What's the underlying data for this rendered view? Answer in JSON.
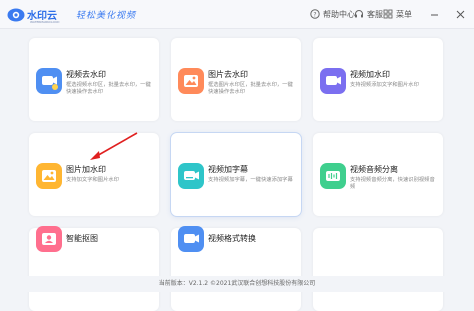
{
  "app": {
    "name": "水印云",
    "subtitle": "WATERMARKCLOUD",
    "slogan": "轻松美化视频"
  },
  "toolbar": {
    "help_label": "帮助中心",
    "service_label": "客服",
    "menu_label": "菜单"
  },
  "cards": [
    {
      "title": "视频去水印",
      "desc": "框选视频水印区，批量去水印，一键快速操作去水印"
    },
    {
      "title": "图片去水印",
      "desc": "框选图片水印区，批量去水印，一键快速操作去水印"
    },
    {
      "title": "视频加水印",
      "desc": "支持视频添加文字和图片水印"
    },
    {
      "title": "图片加水印",
      "desc": "支持加文字和图片水印"
    },
    {
      "title": "视频加字幕",
      "desc": "支持视频加字幕，一键快速添加字幕"
    },
    {
      "title": "视频音频分离",
      "desc": "支持视频音频分离，快速识别视频音频"
    },
    {
      "title": "智能抠图",
      "desc": ""
    },
    {
      "title": "视频格式转换",
      "desc": ""
    }
  ],
  "footer": {
    "text": "当前版本：V2.1.2 ©2021武汉联合创想科技股份有限公司"
  },
  "colors": {
    "brand": "#2f6fe8",
    "blue_icon": "#4f8ff2",
    "orange_icon": "#ff8a5a",
    "purple_icon": "#7b6ff0",
    "yellow_icon": "#ffb632",
    "cyan_icon": "#2ec5c9",
    "green_icon": "#3fcf8e",
    "annotation_arrow": "#e02020"
  }
}
